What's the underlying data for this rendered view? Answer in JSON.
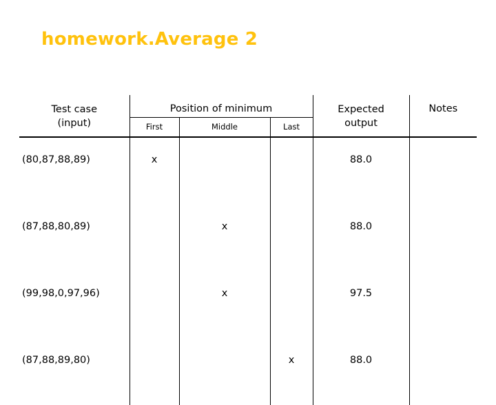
{
  "slide": {
    "title": "homework.Average 2",
    "title_color": "#FFC20E"
  },
  "table": {
    "headers": {
      "test_case": "Test case\n(input)",
      "test_case_line1": "Test case",
      "test_case_line2": "(input)",
      "position_group": "Position of minimum",
      "position_first": "First",
      "position_middle": "Middle",
      "position_last": "Last",
      "expected_line1": "Expected",
      "expected_line2": "output",
      "notes": "Notes"
    },
    "rows": [
      {
        "input": "(80,87,88,89)",
        "first": "x",
        "middle": "",
        "last": "",
        "expected": "88.0",
        "notes": ""
      },
      {
        "input": "(87,88,80,89)",
        "first": "",
        "middle": "x",
        "last": "",
        "expected": "88.0",
        "notes": ""
      },
      {
        "input": "(99,98,0,97,96)",
        "first": "",
        "middle": "x",
        "last": "",
        "expected": "97.5",
        "notes": ""
      },
      {
        "input": "(87,88,89,80)",
        "first": "",
        "middle": "",
        "last": "x",
        "expected": "88.0",
        "notes": ""
      }
    ]
  }
}
